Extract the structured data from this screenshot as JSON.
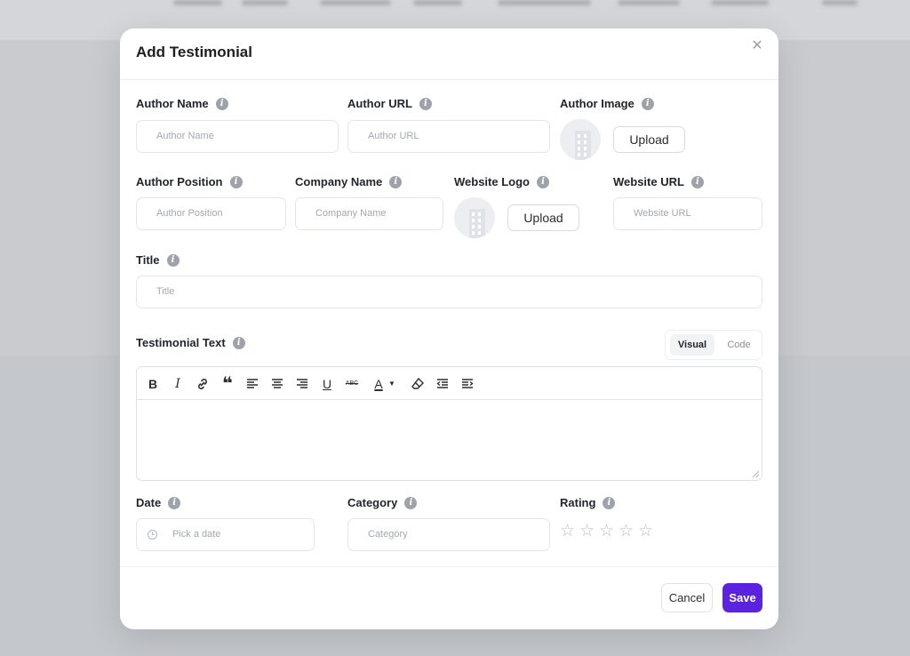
{
  "modal": {
    "title": "Add Testimonial",
    "close_icon": "close-icon"
  },
  "fields": {
    "author_name": {
      "label": "Author Name",
      "placeholder": "Author Name"
    },
    "author_url": {
      "label": "Author URL",
      "placeholder": "Author URL"
    },
    "author_image": {
      "label": "Author Image",
      "upload_label": "Upload"
    },
    "author_position": {
      "label": "Author Position",
      "placeholder": "Author Position"
    },
    "company_name": {
      "label": "Company Name",
      "placeholder": "Company Name"
    },
    "website_logo": {
      "label": "Website Logo",
      "upload_label": "Upload"
    },
    "website_url": {
      "label": "Website URL",
      "placeholder": "Website URL"
    },
    "title": {
      "label": "Title",
      "placeholder": "Title"
    },
    "testimonial_text": {
      "label": "Testimonial Text"
    },
    "date": {
      "label": "Date",
      "placeholder": "Pick a date"
    },
    "category": {
      "label": "Category",
      "placeholder": "Category"
    },
    "rating": {
      "label": "Rating",
      "stars": [
        "☆",
        "☆",
        "☆",
        "☆",
        "☆"
      ]
    }
  },
  "editor": {
    "tabs": [
      {
        "label": "Visual",
        "active": true
      },
      {
        "label": "Code",
        "active": false
      }
    ],
    "toolbar": [
      {
        "name": "bold-icon",
        "glyph": "B"
      },
      {
        "name": "italic-icon",
        "glyph": "I"
      },
      {
        "name": "link-icon",
        "glyph": "🔗"
      },
      {
        "name": "blockquote-icon",
        "glyph": "❝"
      },
      {
        "name": "align-left-icon",
        "glyph": "≡"
      },
      {
        "name": "align-center-icon",
        "glyph": "≡"
      },
      {
        "name": "align-right-icon",
        "glyph": "≡"
      },
      {
        "name": "underline-icon",
        "glyph": "U"
      },
      {
        "name": "strikethrough-icon",
        "glyph": "ABC"
      },
      {
        "name": "text-color-icon",
        "glyph": "A"
      },
      {
        "name": "clear-formatting-icon",
        "glyph": "⌫"
      },
      {
        "name": "outdent-icon",
        "glyph": "⇤"
      },
      {
        "name": "indent-icon",
        "glyph": "⇥"
      }
    ]
  },
  "footer": {
    "cancel_label": "Cancel",
    "save_label": "Save"
  },
  "colors": {
    "primary": "#5b22e0",
    "overlay": "#c9cbcf"
  }
}
